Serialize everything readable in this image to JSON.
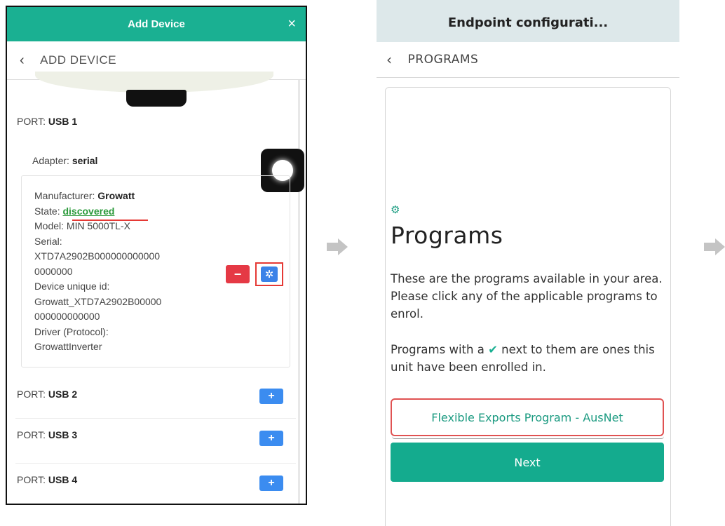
{
  "add_device": {
    "window_title": "Add Device",
    "close_icon": "×",
    "back_icon": "‹",
    "nav_title": "ADD DEVICE",
    "port_prefix": "PORT:",
    "ports": [
      {
        "name": "USB 1"
      },
      {
        "name": "USB 2"
      },
      {
        "name": "USB 3"
      },
      {
        "name": "USB 4"
      }
    ],
    "adapter_label": "Adapter:",
    "adapter_value": "serial",
    "manufacturer_label": "Manufacturer:",
    "manufacturer_value": "Growatt",
    "state_label": "State:",
    "state_value": "discovered",
    "model_line": "Model: MIN 5000TL-X",
    "serial_label": "Serial:",
    "serial_line1": "XTD7A2902B000000000000",
    "serial_line2": "0000000",
    "device_uid_label": "Device unique id:",
    "device_uid_line1": "Growatt_XTD7A2902B00000",
    "device_uid_line2": "000000000000",
    "driver_label": "Driver (Protocol):",
    "driver_value": "GrowattInverter",
    "minus_label": "−",
    "plus_label": "+",
    "wrench_icon": "✲"
  },
  "programs": {
    "window_title": "Endpoint configurati...",
    "back_icon": "‹",
    "nav_title": "PROGRAMS",
    "gear_icon": "⚙",
    "heading": "Programs",
    "paragraph1": "These are the programs available in your area. Please click any of the applicable programs to enrol.",
    "paragraph2_part1": "Programs with a",
    "check_icon": "✔",
    "paragraph2_part2": "next to them are ones this unit have been enrolled in.",
    "program_button": "Flexible Exports Program - AusNet",
    "next_button": "Next"
  },
  "colors": {
    "teal": "#1ab092",
    "highlight_red": "#e53935",
    "blue_button": "#3b8cf0",
    "topbar_bg": "#dde8ea"
  }
}
